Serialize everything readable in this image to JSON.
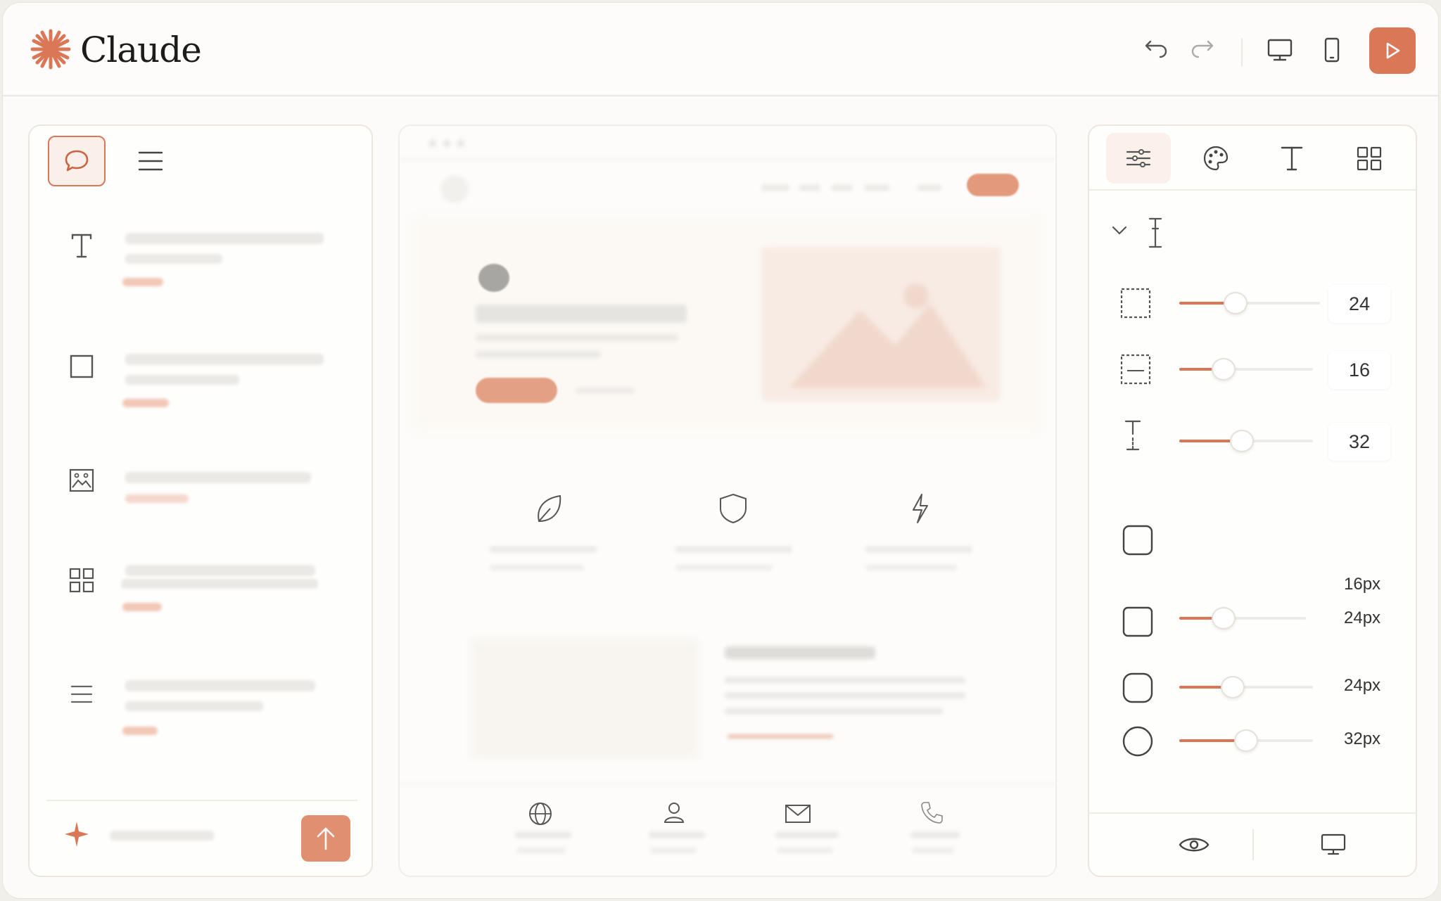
{
  "app": {
    "title": "Claude"
  },
  "header": {
    "undo_icon": "undo-icon",
    "redo_icon": "redo-icon",
    "desktop_icon": "desktop-icon",
    "mobile_icon": "mobile-icon",
    "play_icon": "play-icon"
  },
  "colors": {
    "accent": "#d97757",
    "accent_light": "#f2c7b6",
    "border": "#ebe7e0"
  },
  "left_panel": {
    "tabs": [
      "chat-icon",
      "menu-icon"
    ],
    "components": [
      "text-icon",
      "square-icon",
      "image-icon",
      "grid-icon",
      "list-icon"
    ],
    "chat_input": {
      "spark_icon": "sparkle-icon",
      "send_icon": "arrow-up-icon"
    }
  },
  "preview": {
    "features": [
      "leaf-icon",
      "shield-icon",
      "lightning-icon"
    ],
    "footer": [
      "globe-icon",
      "user-icon",
      "mail-icon",
      "phone-icon"
    ]
  },
  "right_panel": {
    "tabs": [
      "sliders-icon",
      "palette-icon",
      "type-icon",
      "layout-grid-icon"
    ],
    "spacing": {
      "padding": {
        "value": "24",
        "level": 0.4
      },
      "margin": {
        "value": "16",
        "level": 0.33
      },
      "line_height": {
        "value": "32",
        "level": 0.47
      }
    },
    "radius": {
      "labels": [
        "16px",
        "24px",
        "24px",
        "32px"
      ],
      "levels": [
        0.35,
        0.4,
        0.5
      ]
    },
    "bottom": [
      "eye-icon",
      "monitor-icon"
    ]
  }
}
